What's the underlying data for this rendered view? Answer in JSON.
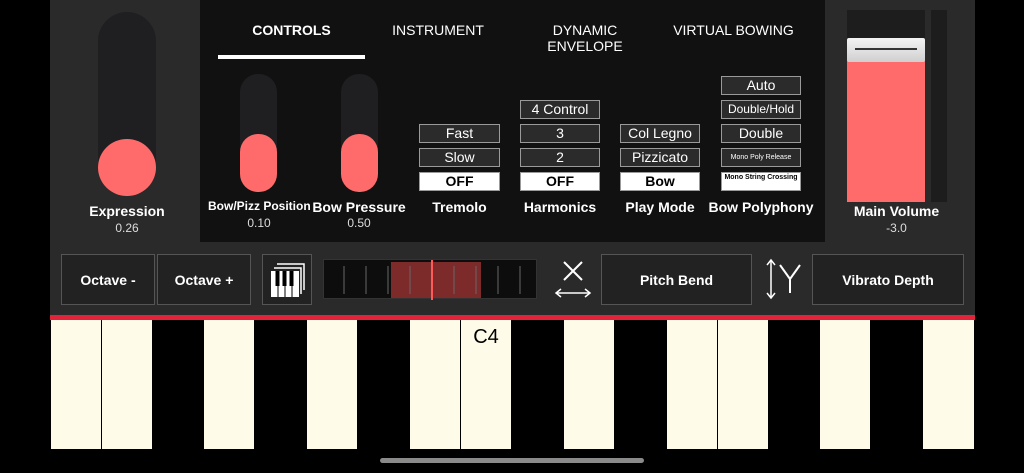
{
  "tabs": [
    {
      "label": "CONTROLS",
      "active": true
    },
    {
      "label": "INSTRUMENT",
      "active": false
    },
    {
      "label": "DYNAMIC ENVELOPE",
      "active": false
    },
    {
      "label": "VIRTUAL BOWING",
      "active": false
    }
  ],
  "expression": {
    "label": "Expression",
    "value": "0.26"
  },
  "bow_position": {
    "label": "Bow/Pizz Position",
    "value": "0.10"
  },
  "bow_pressure": {
    "label": "Bow Pressure",
    "value": "0.50"
  },
  "tremolo": {
    "label": "Tremolo",
    "options": [
      "Fast",
      "Slow",
      "OFF"
    ],
    "selected": "OFF"
  },
  "harmonics": {
    "label": "Harmonics",
    "options": [
      "4 Control",
      "3",
      "2",
      "OFF"
    ],
    "selected": "OFF"
  },
  "play_mode": {
    "label": "Play Mode",
    "options": [
      "Col Legno",
      "Pizzicato",
      "Bow"
    ],
    "selected": "Bow"
  },
  "bow_polyphony": {
    "label": "Bow Polyphony",
    "options": [
      "Auto",
      "Double/Hold",
      "Double",
      "Mono Poly Release",
      "Mono String Crossing"
    ],
    "selected": "Mono String Crossing"
  },
  "main_volume": {
    "label": "Main Volume",
    "value": "-3.0"
  },
  "controls": {
    "octave_down": "Octave -",
    "octave_up": "Octave +",
    "pitch_bend": "Pitch Bend",
    "vibrato_depth": "Vibrato Depth"
  },
  "keyboard": {
    "note_label": "C4"
  },
  "colors": {
    "accent": "#ff6b6b",
    "red_line": "#e2233a",
    "key_white": "#fefbe8"
  }
}
